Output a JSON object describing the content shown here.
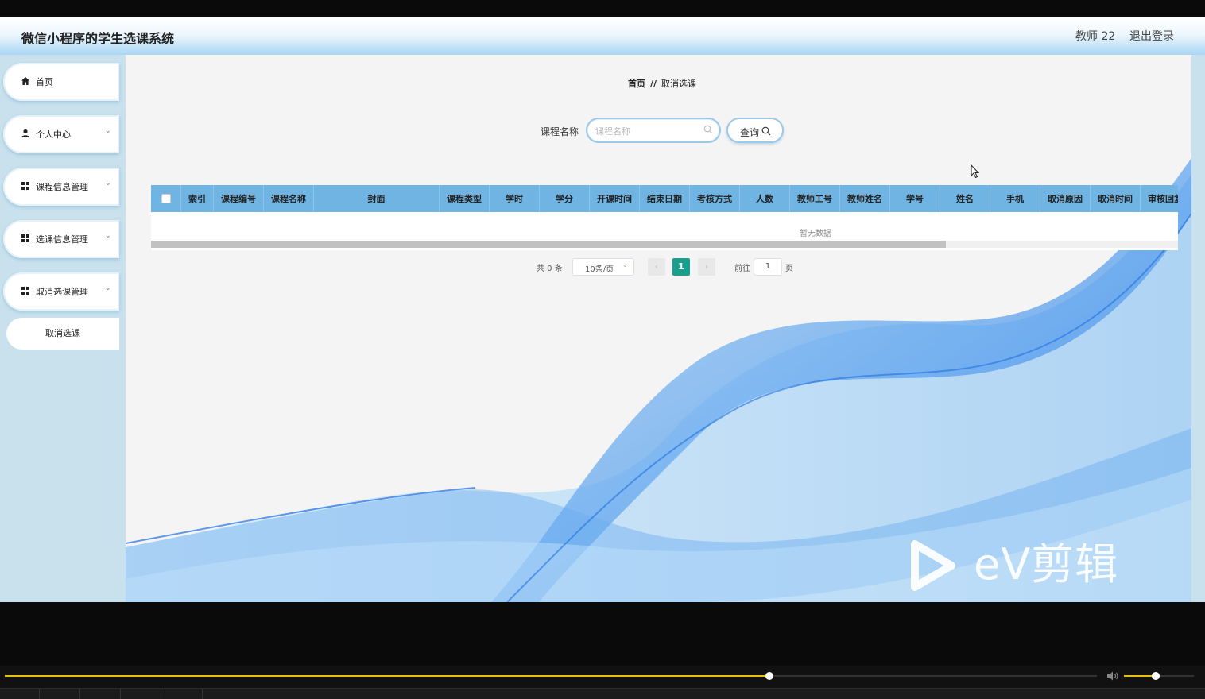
{
  "header": {
    "title": "微信小程序的学生选课系统",
    "user": "教师 22",
    "logout": "退出登录"
  },
  "sidebar": {
    "items": [
      {
        "label": "首页",
        "icon": "home-icon",
        "has_children": false
      },
      {
        "label": "个人中心",
        "icon": "user-icon",
        "has_children": true
      },
      {
        "label": "课程信息管理",
        "icon": "grid-icon",
        "has_children": true
      },
      {
        "label": "选课信息管理",
        "icon": "grid-icon",
        "has_children": true
      },
      {
        "label": "取消选课管理",
        "icon": "grid-icon",
        "has_children": true
      }
    ],
    "sub_item": "取消选课"
  },
  "breadcrumb": {
    "home": "首页",
    "separator": "//",
    "current": "取消选课"
  },
  "search": {
    "label": "课程名称",
    "placeholder": "课程名称",
    "value": "",
    "button": "查询"
  },
  "table": {
    "columns": [
      "索引",
      "课程编号",
      "课程名称",
      "封面",
      "课程类型",
      "学时",
      "学分",
      "开课时间",
      "结束日期",
      "考核方式",
      "人数",
      "教师工号",
      "教师姓名",
      "学号",
      "姓名",
      "手机",
      "取消原因",
      "取消时间",
      "审核回复"
    ],
    "rows": [],
    "empty_text": "暂无数据",
    "header_color": "#6fb4e2"
  },
  "pagination": {
    "total": "共 0 条",
    "page_size": "10条/页",
    "current_page": "1",
    "goto_label": "前往",
    "goto_value": "1",
    "page_suffix": "页",
    "active_color": "#1a9f8c"
  },
  "watermark": {
    "text": "eV剪辑"
  },
  "player": {
    "progress": 0.7,
    "volume": 0.45,
    "accent": "#e8c100"
  }
}
